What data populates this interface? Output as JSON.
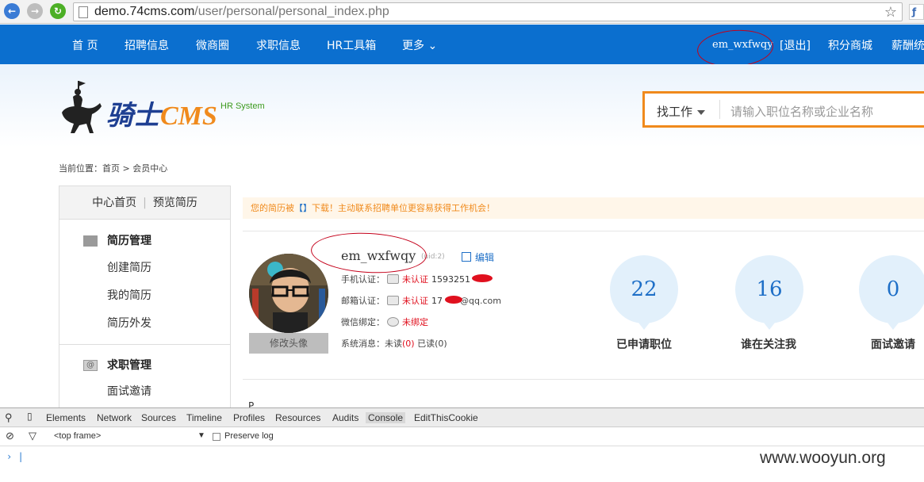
{
  "browser": {
    "url_domain": "demo.74cms.com",
    "url_path": "/user/personal/personal_index.php"
  },
  "topnav": {
    "items": [
      "首 页",
      "招聘信息",
      "微商圈",
      "求职信息",
      "HR工具箱",
      "更多"
    ],
    "username": "em_wxfwqy",
    "logout": "[退出]",
    "points_mall": "积分商城",
    "salary": "薪酬统"
  },
  "logo": {
    "brand_cn": "骑士",
    "brand_en": "CMS",
    "tagline": "HR System"
  },
  "search": {
    "type_label": "找工作",
    "placeholder": "请输入职位名称或企业名称"
  },
  "breadcrumb": "当前位置：首页 > 会员中心",
  "sidebar": {
    "home": "中心首页",
    "preview": "预览简历",
    "sections": [
      {
        "title": "简历管理",
        "items": [
          "创建简历",
          "我的简历",
          "简历外发"
        ]
      },
      {
        "title": "求职管理",
        "items": [
          "面试邀请"
        ]
      }
    ]
  },
  "notice": {
    "pre": "您的简历被",
    "bracket": "【】",
    "post": "下载！主动联系招聘单位更容易获得工作机会！"
  },
  "profile": {
    "avatar_button": "修改头像",
    "username": "em_wxfwqy",
    "uid": "(uid:2)",
    "edit": "编辑",
    "phone_label": "手机认证：",
    "phone_status": "未认证",
    "phone_value": "1593251",
    "email_label": "邮箱认证：",
    "email_status": "未认证",
    "email_prefix": "17",
    "email_suffix": "@qq.com",
    "wechat_label": "微信绑定：",
    "wechat_status": "未绑定",
    "msg_label": "系统消息：",
    "msg_unread_label": "未读",
    "msg_unread": "(0)",
    "msg_read_label": "已读",
    "msg_read": "(0)"
  },
  "stats": [
    {
      "value": "22",
      "label": "已申请职位"
    },
    {
      "value": "16",
      "label": "谁在关注我"
    },
    {
      "value": "0",
      "label": "面试邀请"
    }
  ],
  "truncated_text": "P",
  "devtools": {
    "tabs": [
      "Elements",
      "Network",
      "Sources",
      "Timeline",
      "Profiles",
      "Resources",
      "Audits",
      "Console",
      "EditThisCookie"
    ],
    "active_tab": "Console",
    "frame": "<top frame>",
    "preserve_log": "Preserve log",
    "prompt": "›"
  },
  "watermark": "www.wooyun.org",
  "colors": {
    "nav_blue": "#0b6fcf",
    "accent_orange": "#f08a1c",
    "alert_red": "#e0101e",
    "link_blue": "#1e6fc7"
  }
}
